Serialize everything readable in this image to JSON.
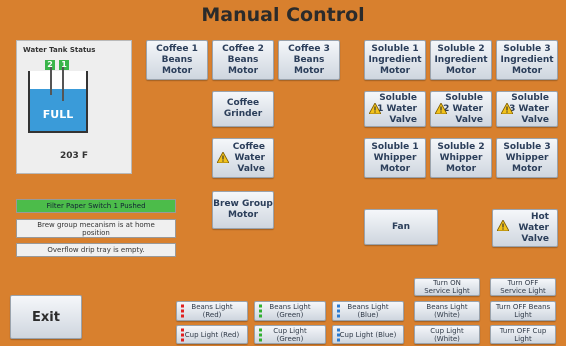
{
  "title": "Manual Control",
  "tank": {
    "label": "Water Tank Status",
    "level_text": "FULL",
    "temperature": "203 F",
    "indicator_left": "2",
    "indicator_right": "1"
  },
  "motors": {
    "coffee1": "Coffee 1\nBeans\nMotor",
    "coffee2": "Coffee 2\nBeans\nMotor",
    "coffee3": "Coffee 3\nBeans\nMotor",
    "soluble1": "Soluble 1\nIngredient\nMotor",
    "soluble2": "Soluble 2\nIngredient\nMotor",
    "soluble3": "Soluble 3\nIngredient\nMotor"
  },
  "grinder": "Coffee\nGrinder",
  "coffee_valve": "Coffee\nWater\nValve",
  "brew_group": "Brew Group\nMotor",
  "valves": {
    "s1": "Soluble\n1 Water\nValve",
    "s2": "Soluble\n2 Water\nValve",
    "s3": "Soluble\n3 Water\nValve"
  },
  "whippers": {
    "w1": "Soluble 1\nWhipper\nMotor",
    "w2": "Soluble 2\nWhipper\nMotor",
    "w3": "Soluble 3\nWhipper\nMotor"
  },
  "fan": "Fan",
  "hot_water": "Hot\nWater\nValve",
  "statuses": {
    "filter": "Filter Paper Switch 1 Pushed",
    "brew": "Brew group mecanism is at home\nposition",
    "drip": "Overflow drip tray is empty."
  },
  "exit": "Exit",
  "service": {
    "on": "Turn ON\nService Light",
    "off": "Turn OFF\nService Light"
  },
  "beans_lights": {
    "red": "Beans Light\n(Red)",
    "green": "Beans Light\n(Green)",
    "blue": "Beans Light\n(Blue)",
    "white": "Beans Light\n(White)",
    "off": "Turn OFF Beans\nLight"
  },
  "cup_lights": {
    "red": "Cup Light (Red)",
    "green": "Cup Light\n(Green)",
    "blue": "Cup Light (Blue)",
    "white": "Cup Light\n(White)",
    "off": "Turn OFF Cup\nLight"
  },
  "colors": {
    "background": "#d8802e",
    "water": "#3a9bd9",
    "status_ok": "#4cbc4a",
    "led_red": "#e02020",
    "led_green": "#30b030",
    "led_blue": "#2a7ad0",
    "led_white": "#f4f4f4"
  }
}
